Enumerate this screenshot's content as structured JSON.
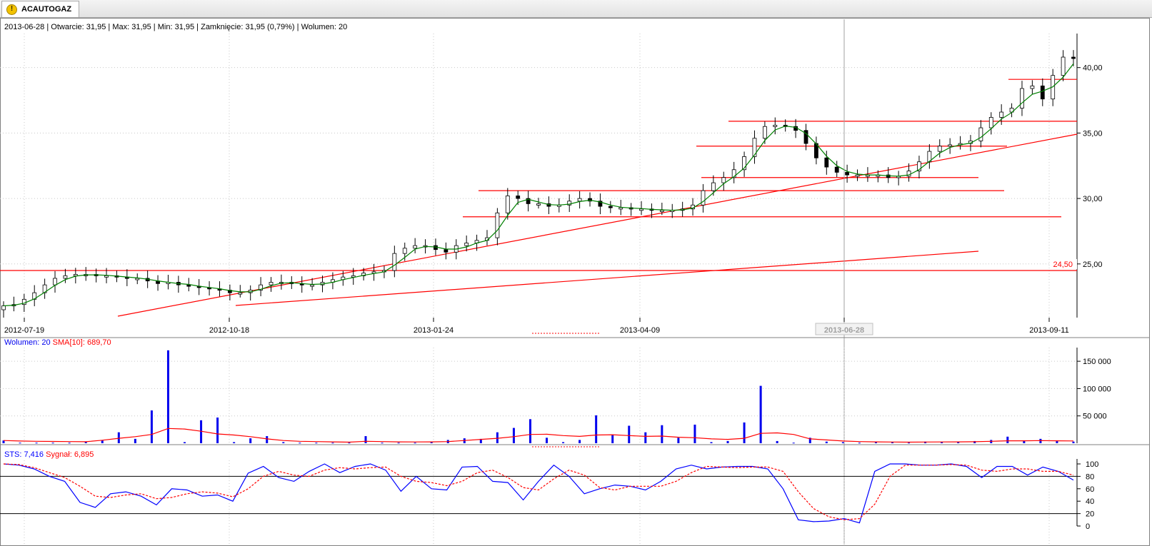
{
  "tab": {
    "symbol": "ACAUTOGAZ",
    "icon": "warning-icon"
  },
  "info_line": {
    "date": "2013-06-28",
    "open_label": "Otwarcie:",
    "open": "31,95",
    "max_label": "Max:",
    "max": "31,95",
    "min_label": "Min:",
    "min": "31,95",
    "close_label": "Zamknięcie:",
    "close": "31,95",
    "change": "(0,79%)",
    "volume_label": "Wolumen:",
    "volume": "20"
  },
  "volume_header": {
    "label": "Wolumen: 20",
    "sma": "SMA[10]: 689,70"
  },
  "sts_header": {
    "label": "STS: 7,416",
    "signal": "Sygnał: 6,895"
  },
  "colors": {
    "support": "#ff0000",
    "sma": "#008000",
    "volume": "#0000ee",
    "sts": "#0000ff",
    "signal": "#ff0000"
  },
  "chart_data": [
    {
      "type": "candlestick",
      "x_tick_labels": [
        "2012-07-19",
        "2012-10-18",
        "2013-01-24",
        "2013-04-09",
        "2013-06-28",
        "2013-09-11"
      ],
      "crosshair_label": "2013-06-28",
      "y_ticks": [
        "25,00",
        "30,00",
        "35,00",
        "40,00"
      ],
      "ylim": [
        20.9,
        42.6
      ],
      "price_marker": "24,50",
      "horizontal_levels": [
        24.5,
        28.6,
        30.6,
        31.6,
        34.0,
        35.9,
        39.1
      ],
      "close_series": [
        21.8,
        21.9,
        22.3,
        22.8,
        23.4,
        23.9,
        24.1,
        24.2,
        24.2,
        24.1,
        24.1,
        24.0,
        23.9,
        23.9,
        23.7,
        23.5,
        23.6,
        23.4,
        23.3,
        23.2,
        23.1,
        23.0,
        22.8,
        22.8,
        23.0,
        23.4,
        23.6,
        23.6,
        23.5,
        23.4,
        23.4,
        23.6,
        23.8,
        24.0,
        24.1,
        24.3,
        24.4,
        24.5,
        25.8,
        26.2,
        26.4,
        26.4,
        26.1,
        25.9,
        26.4,
        26.6,
        26.8,
        27.0,
        28.9,
        30.2,
        30.0,
        29.6,
        29.6,
        29.4,
        29.5,
        29.8,
        30.0,
        29.8,
        29.4,
        29.3,
        29.3,
        29.2,
        29.2,
        29.1,
        29.1,
        29.1,
        29.2,
        29.5,
        30.6,
        31.2,
        31.6,
        32.2,
        33.2,
        34.6,
        35.5,
        35.6,
        35.5,
        35.2,
        34.2,
        33.1,
        32.4,
        32.0,
        31.8,
        31.8,
        31.8,
        31.8,
        31.6,
        31.7,
        32.1,
        32.8,
        33.6,
        34.0,
        34.1,
        34.2,
        34.4,
        35.4,
        36.2,
        36.6,
        36.9,
        38.4,
        38.6,
        37.6,
        39.4,
        40.8,
        40.7
      ]
    },
    {
      "type": "bar",
      "series": [
        {
          "name": "Wolumen",
          "values": [
            5000,
            1000,
            1000,
            1000,
            1000,
            2000,
            5000,
            20000,
            8000,
            60000,
            170000,
            2000,
            42000,
            47000,
            2000,
            9000,
            13000,
            2000,
            1000,
            1000,
            1000,
            1000,
            13000,
            1000,
            1000,
            1000,
            3000,
            6000,
            9000,
            8000,
            20000,
            28000,
            44000,
            10000,
            2000,
            6000,
            51000,
            15000,
            32000,
            20000,
            33000,
            10000,
            34000,
            2000,
            4000,
            38000,
            105000,
            4000,
            1000,
            10000,
            3000,
            2000,
            1000,
            2000,
            2000,
            1000,
            3000,
            2000,
            3000,
            4000,
            6000,
            12000,
            4000,
            8000,
            5000,
            3000
          ]
        },
        {
          "name": "SMA[10]",
          "values": [
            5000,
            4000,
            3500,
            3200,
            3000,
            2800,
            5500,
            9000,
            12000,
            16000,
            27000,
            26000,
            22000,
            17000,
            15000,
            12000,
            8000,
            5000,
            3500,
            3000,
            2500,
            2000,
            3500,
            3000,
            2500,
            2400,
            2500,
            3000,
            5000,
            7000,
            9000,
            12000,
            16000,
            16500,
            14000,
            12500,
            15000,
            15500,
            14000,
            12500,
            13000,
            11000,
            10000,
            8000,
            7000,
            9000,
            18000,
            19000,
            16000,
            8000,
            6000,
            4000,
            3000,
            2500,
            2200,
            2000,
            2200,
            2300,
            2500,
            2800,
            3500,
            4500,
            4500,
            4800,
            4500,
            4200
          ]
        }
      ],
      "y_ticks": [
        "50 000",
        "100 000",
        "150 000"
      ],
      "ylim": [
        0,
        175000
      ]
    },
    {
      "type": "line",
      "series": [
        {
          "name": "STS",
          "values": [
            100,
            98,
            92,
            80,
            72,
            38,
            30,
            52,
            55,
            48,
            34,
            60,
            58,
            48,
            50,
            40,
            85,
            96,
            78,
            72,
            88,
            100,
            86,
            96,
            100,
            90,
            56,
            80,
            60,
            58,
            95,
            96,
            72,
            70,
            42,
            72,
            98,
            80,
            52,
            60,
            66,
            64,
            58,
            72,
            92,
            98,
            92,
            95,
            96,
            96,
            92,
            60,
            10,
            7,
            8,
            12,
            5,
            88,
            100,
            100,
            98,
            98,
            100,
            96,
            78,
            96,
            96,
            82,
            95,
            88,
            74
          ]
        },
        {
          "name": "Sygnał",
          "values": [
            100,
            99,
            94,
            86,
            78,
            64,
            48,
            46,
            50,
            52,
            44,
            46,
            52,
            55,
            53,
            47,
            60,
            80,
            88,
            82,
            80,
            90,
            94,
            92,
            94,
            95,
            80,
            72,
            70,
            65,
            72,
            86,
            90,
            78,
            62,
            58,
            76,
            90,
            82,
            62,
            58,
            64,
            64,
            64,
            72,
            86,
            96,
            95,
            94,
            95,
            95,
            88,
            55,
            28,
            15,
            10,
            12,
            35,
            80,
            98,
            98,
            98,
            99,
            98,
            90,
            88,
            92,
            92,
            88,
            88,
            82
          ]
        }
      ],
      "y_ticks": [
        "0",
        "20",
        "40",
        "60",
        "80",
        "100"
      ],
      "ylim": [
        0,
        100
      ],
      "reference_lines": [
        20,
        80
      ]
    }
  ]
}
